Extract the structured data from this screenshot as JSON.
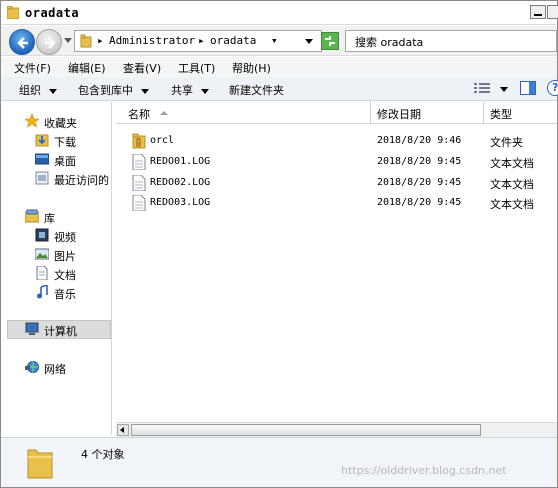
{
  "window": {
    "title": "oradata"
  },
  "address": {
    "crumbs": [
      "Administrator",
      "oradata"
    ],
    "search_text": "搜索 oradata"
  },
  "menubar": {
    "items": [
      "文件(F)",
      "编辑(E)",
      "查看(V)",
      "工具(T)",
      "帮助(H)"
    ]
  },
  "toolbar": {
    "organize": "组织",
    "include_library": "包含到库中",
    "share": "共享",
    "new_folder": "新建文件夹"
  },
  "navigation": {
    "favorites": "收藏夹",
    "downloads": "下载",
    "desktop": "桌面",
    "recent": "最近访问的",
    "libraries": "库",
    "videos": "视频",
    "pictures": "图片",
    "documents": "文档",
    "music": "音乐",
    "computer": "计算机",
    "network": "网络"
  },
  "filelist": {
    "columns": {
      "name": "名称",
      "modified": "修改日期",
      "type": "类型"
    },
    "rows": [
      {
        "name": "orcl",
        "modified": "2018/8/20 9:46",
        "type": "文件夹",
        "icon": "locked-folder-icon"
      },
      {
        "name": "REDO01.LOG",
        "modified": "2018/8/20 9:45",
        "type": "文本文档",
        "icon": "text-file-icon"
      },
      {
        "name": "REDO02.LOG",
        "modified": "2018/8/20 9:45",
        "type": "文本文档",
        "icon": "text-file-icon"
      },
      {
        "name": "REDO03.LOG",
        "modified": "2018/8/20 9:45",
        "type": "文本文档",
        "icon": "text-file-icon"
      }
    ]
  },
  "details": {
    "item_count": "4 个对象"
  },
  "watermark": "https://olddriver.blog.csdn.net",
  "colors": {
    "folder": "#e8c04a",
    "selection": "#dcdcdc",
    "details_bg": "#f1f4f8"
  }
}
